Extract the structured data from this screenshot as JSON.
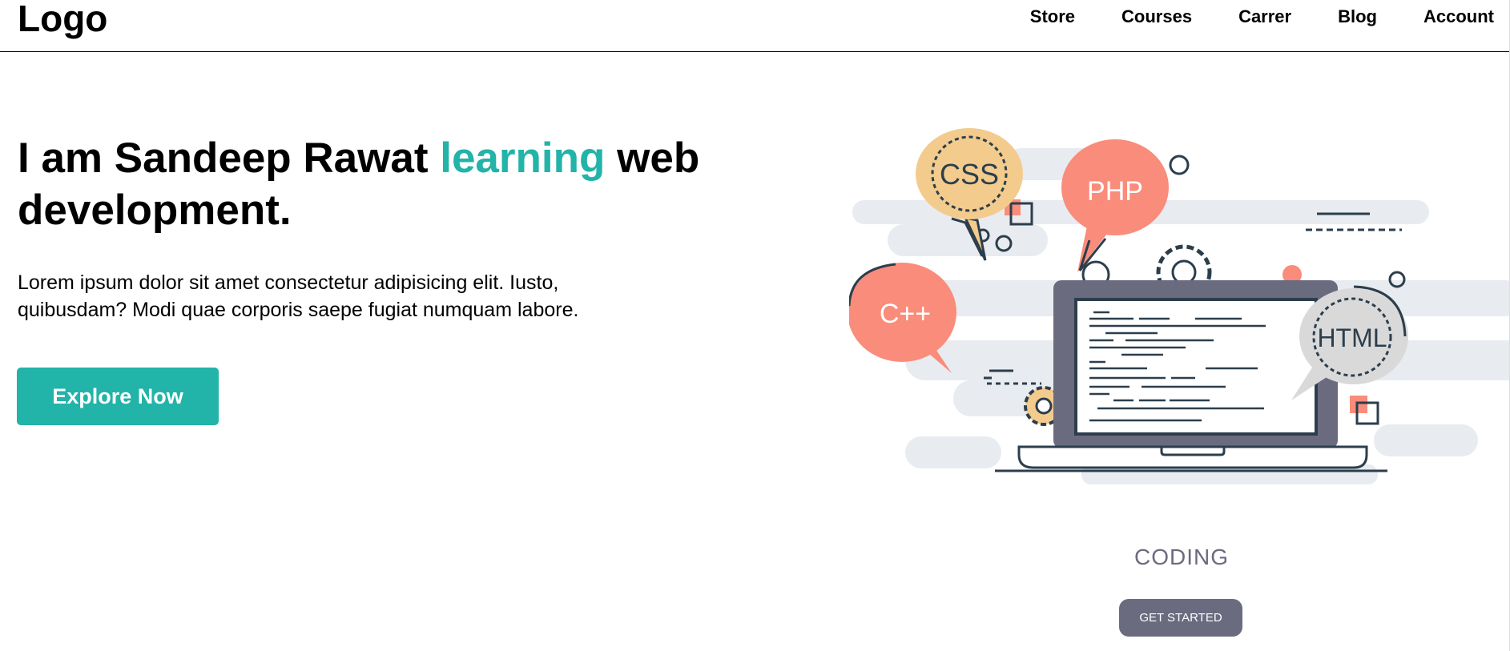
{
  "nav": {
    "logo": "Logo",
    "links": [
      "Store",
      "Courses",
      "Carrer",
      "Blog",
      "Account"
    ]
  },
  "hero": {
    "title_before": "I am Sandeep Rawat ",
    "title_accent": "learning",
    "title_after": " web development.",
    "description": "Lorem ipsum dolor sit amet consectetur adipisicing elit. Iusto, quibusdam? Modi quae corporis saepe fugiat numquam labore.",
    "button_label": "Explore Now"
  },
  "illustration": {
    "bubbles": [
      "CSS",
      "PHP",
      "C++",
      "HTML"
    ]
  },
  "coding_section": {
    "label": "CODING",
    "button_label": "GET STARTED"
  },
  "colors": {
    "accent": "#22b3a9",
    "muted": "#6b6b80",
    "coral": "#f98c7a",
    "sand": "#f3cb8d",
    "cloud": "#e8ebef",
    "outline": "#2c3e4c"
  }
}
